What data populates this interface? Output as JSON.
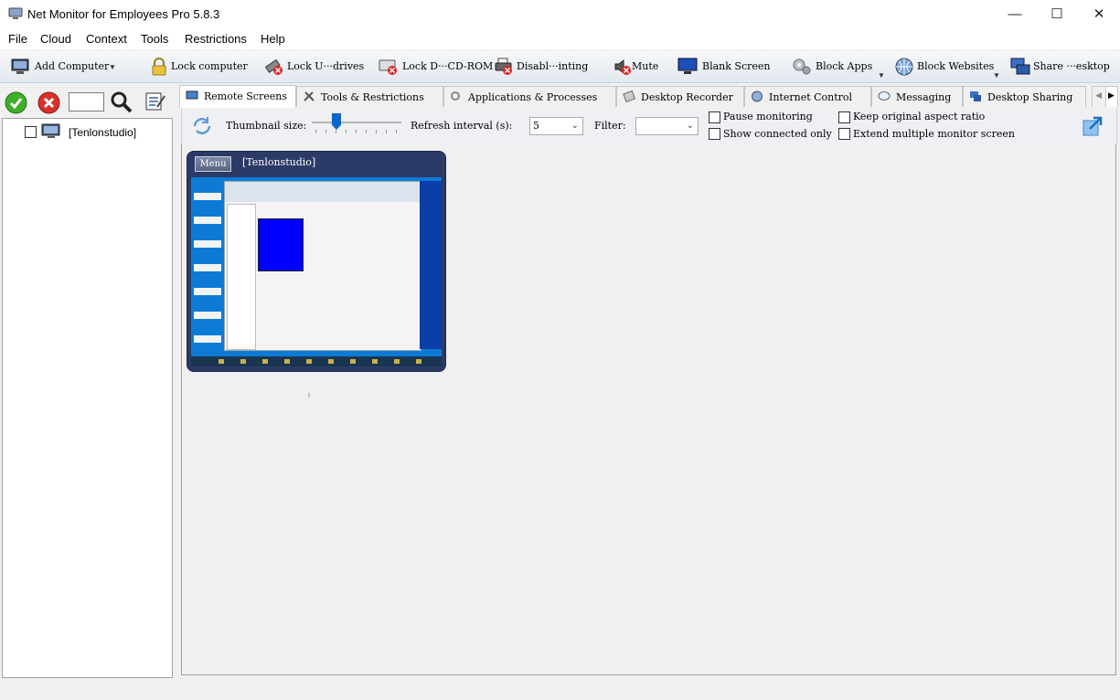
{
  "window": {
    "title": "Net Monitor for Employees Pro 5.8.3",
    "minimize": "—",
    "maximize": "☐",
    "close": "✕"
  },
  "menu": [
    "File",
    "Cloud",
    "Context",
    "Tools",
    "Restrictions",
    "Help"
  ],
  "toolbar": [
    {
      "label": "Add Computer",
      "icon": "add-computer-icon"
    },
    {
      "label": "Lock computer",
      "icon": "lock-icon"
    },
    {
      "label": "Lock U···drives",
      "icon": "usb-lock-icon"
    },
    {
      "label": "Lock D···CD-ROM",
      "icon": "cdrom-lock-icon"
    },
    {
      "label": "Disabl···inting",
      "icon": "printer-disable-icon"
    },
    {
      "label": "Mute",
      "icon": "mute-icon"
    },
    {
      "label": "Blank Screen",
      "icon": "monitor-icon"
    },
    {
      "label": "Block Apps",
      "icon": "gears-icon"
    },
    {
      "label": "Block Websites",
      "icon": "globe-icon"
    },
    {
      "label": "Share ···esktop",
      "icon": "share-desktop-icon"
    }
  ],
  "tree": {
    "items": [
      {
        "label": "[Tenlonstudio]",
        "checked": false
      }
    ]
  },
  "tabs": [
    {
      "label": "Remote Screens",
      "active": true
    },
    {
      "label": "Tools & Restrictions"
    },
    {
      "label": "Applications & Processes"
    },
    {
      "label": "Desktop Recorder"
    },
    {
      "label": "Internet Control"
    },
    {
      "label": "Messaging"
    },
    {
      "label": "Desktop Sharing"
    }
  ],
  "options": {
    "thumb_label": "Thumbnail size:",
    "thumb_level": 0.25,
    "refresh_label": "Refresh interval (s):",
    "refresh_value": "5",
    "filter_label": "Filter:",
    "filter_value": "",
    "pause": "Pause monitoring",
    "show_connected": "Show connected only",
    "keep_ratio": "Keep original aspect ratio",
    "extend": "Extend multiple monitor screen"
  },
  "thumbnail": {
    "menu": "Menu",
    "name": "[Tenlonstudio]"
  },
  "colors": {
    "accent": "#2b3a66",
    "screen_bg": "#0d7bd6",
    "taskbar": "#1a3550"
  }
}
